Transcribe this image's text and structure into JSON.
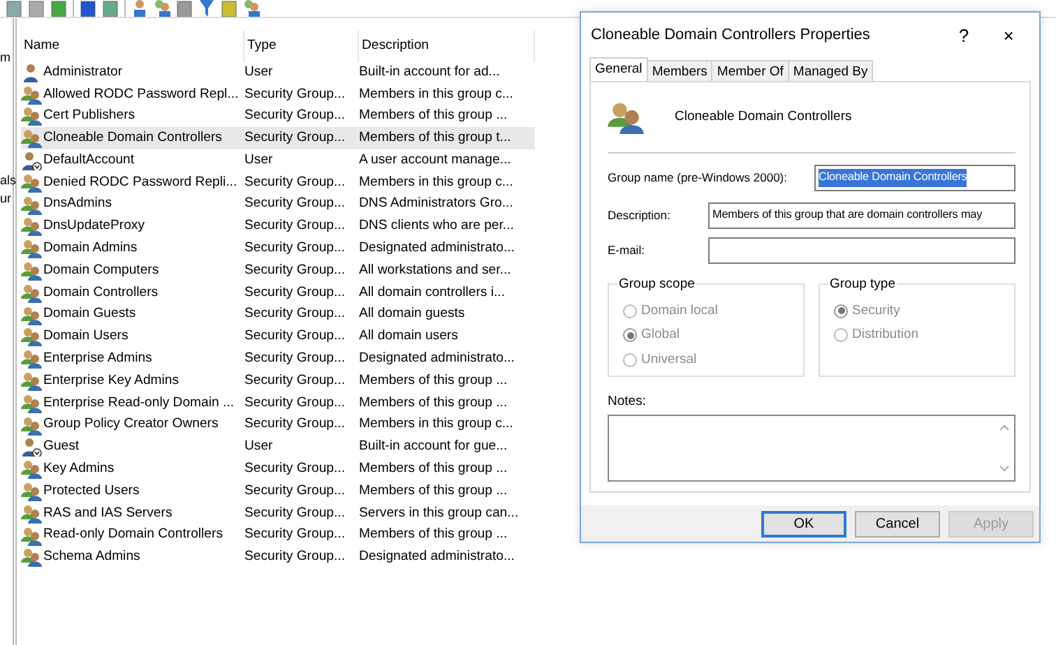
{
  "left_pane_fragments": [
    "m",
    "als",
    "ur"
  ],
  "list": {
    "columns": [
      "Name",
      "Type",
      "Description"
    ],
    "rows": [
      {
        "kind": "user",
        "selected": false,
        "name": "Administrator",
        "type": "User",
        "description": "Built-in account for ad..."
      },
      {
        "kind": "group",
        "selected": false,
        "name": "Allowed RODC Password Repl...",
        "type": "Security Group...",
        "description": "Members in this group c..."
      },
      {
        "kind": "group",
        "selected": false,
        "name": "Cert Publishers",
        "type": "Security Group...",
        "description": "Members of this group ..."
      },
      {
        "kind": "group",
        "selected": true,
        "name": "Cloneable Domain Controllers",
        "type": "Security Group...",
        "description": "Members of this group t..."
      },
      {
        "kind": "disabled-user",
        "selected": false,
        "name": "DefaultAccount",
        "type": "User",
        "description": "A user account manage..."
      },
      {
        "kind": "group",
        "selected": false,
        "name": "Denied RODC Password Repli...",
        "type": "Security Group...",
        "description": "Members in this group c..."
      },
      {
        "kind": "group",
        "selected": false,
        "name": "DnsAdmins",
        "type": "Security Group...",
        "description": "DNS Administrators Gro..."
      },
      {
        "kind": "group",
        "selected": false,
        "name": "DnsUpdateProxy",
        "type": "Security Group...",
        "description": "DNS clients who are per..."
      },
      {
        "kind": "group",
        "selected": false,
        "name": "Domain Admins",
        "type": "Security Group...",
        "description": "Designated administrato..."
      },
      {
        "kind": "group",
        "selected": false,
        "name": "Domain Computers",
        "type": "Security Group...",
        "description": "All workstations and ser..."
      },
      {
        "kind": "group",
        "selected": false,
        "name": "Domain Controllers",
        "type": "Security Group...",
        "description": "All domain controllers i..."
      },
      {
        "kind": "group",
        "selected": false,
        "name": "Domain Guests",
        "type": "Security Group...",
        "description": "All domain guests"
      },
      {
        "kind": "group",
        "selected": false,
        "name": "Domain Users",
        "type": "Security Group...",
        "description": "All domain users"
      },
      {
        "kind": "group",
        "selected": false,
        "name": "Enterprise Admins",
        "type": "Security Group...",
        "description": "Designated administrato..."
      },
      {
        "kind": "group",
        "selected": false,
        "name": "Enterprise Key Admins",
        "type": "Security Group...",
        "description": "Members of this group ..."
      },
      {
        "kind": "group",
        "selected": false,
        "name": "Enterprise Read-only Domain ...",
        "type": "Security Group...",
        "description": "Members of this group ..."
      },
      {
        "kind": "group",
        "selected": false,
        "name": "Group Policy Creator Owners",
        "type": "Security Group...",
        "description": "Members in this group c..."
      },
      {
        "kind": "disabled-user",
        "selected": false,
        "name": "Guest",
        "type": "User",
        "description": "Built-in account for gue..."
      },
      {
        "kind": "group",
        "selected": false,
        "name": "Key Admins",
        "type": "Security Group...",
        "description": "Members of this group ..."
      },
      {
        "kind": "group",
        "selected": false,
        "name": "Protected Users",
        "type": "Security Group...",
        "description": "Members of this group ..."
      },
      {
        "kind": "group",
        "selected": false,
        "name": "RAS and IAS Servers",
        "type": "Security Group...",
        "description": "Servers in this group can..."
      },
      {
        "kind": "group",
        "selected": false,
        "name": "Read-only Domain Controllers",
        "type": "Security Group...",
        "description": "Members of this group ..."
      },
      {
        "kind": "group",
        "selected": false,
        "name": "Schema Admins",
        "type": "Security Group...",
        "description": "Designated administrato..."
      }
    ]
  },
  "dialog": {
    "title": "Cloneable Domain Controllers Properties",
    "help": "?",
    "close": "×",
    "tabs": [
      {
        "label": "General",
        "selected": true
      },
      {
        "label": "Members",
        "selected": false
      },
      {
        "label": "Member Of",
        "selected": false
      },
      {
        "label": "Managed By",
        "selected": false
      }
    ],
    "object_name": "Cloneable Domain Controllers",
    "fields": [
      {
        "label": "Group name (pre-Windows 2000):",
        "value": "Cloneable Domain Controllers",
        "text_selected": true
      },
      {
        "label": "Description:",
        "value": "Members of this group that are domain controllers may",
        "text_selected": false
      },
      {
        "label": "E-mail:"
      }
    ],
    "group_scope": {
      "title": "Group scope",
      "options": [
        {
          "label": "Domain local",
          "selected": false,
          "disabled": true
        },
        {
          "label": "Global",
          "selected": true,
          "disabled": true
        },
        {
          "label": "Universal",
          "selected": false,
          "disabled": true
        }
      ]
    },
    "group_type": {
      "title": "Group type",
      "options": [
        {
          "label": "Security",
          "selected": true,
          "disabled": true
        },
        {
          "label": "Distribution",
          "selected": false,
          "disabled": true
        }
      ]
    },
    "notes_label": "Notes:",
    "buttons": [
      {
        "label": "OK",
        "default": true,
        "disabled": false
      },
      {
        "label": "Cancel",
        "default": false,
        "disabled": false
      },
      {
        "label": "Apply",
        "default": false,
        "disabled": true
      }
    ]
  }
}
